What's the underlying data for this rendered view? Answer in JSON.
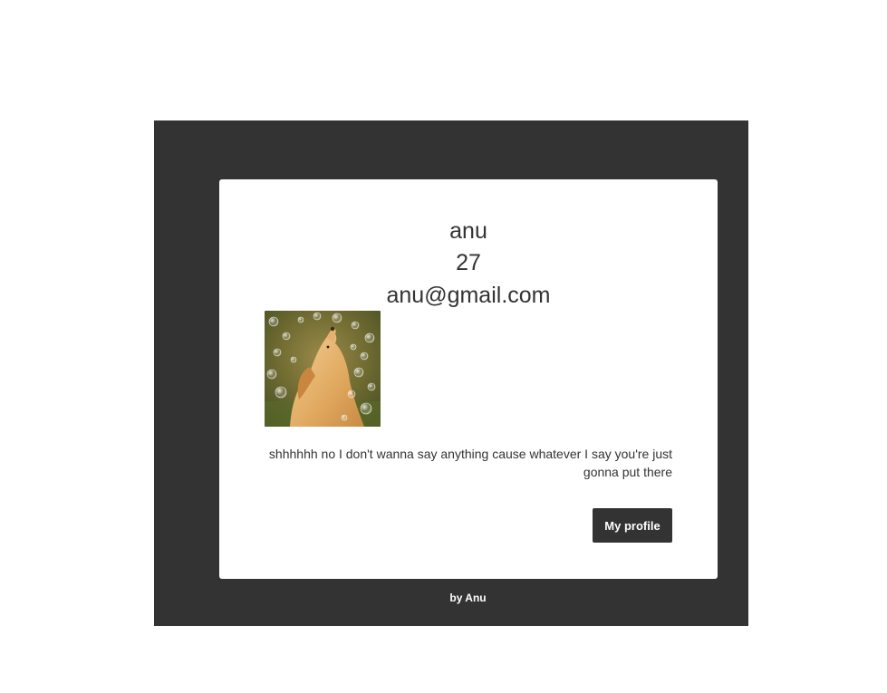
{
  "profile": {
    "name": "anu",
    "age": "27",
    "email": "anu@gmail.com",
    "photo_icon": "dog-photo",
    "bio": "shhhhhh no I don't wanna say anything cause whatever I say you're just gonna put there"
  },
  "actions": {
    "my_profile_label": "My profile"
  },
  "footer": {
    "credit": "by Anu"
  },
  "colors": {
    "frame": "#333333",
    "card": "#ffffff",
    "text": "#333333",
    "button_bg": "#333333",
    "button_text": "#ffffff"
  }
}
